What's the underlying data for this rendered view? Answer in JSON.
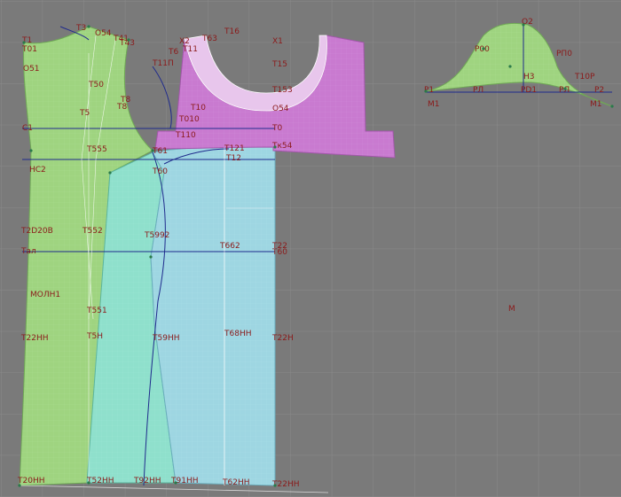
{
  "colors": {
    "background": "#7a7a7a",
    "grid": "#8a8a8a",
    "green_piece": "#9fd480",
    "cyan_piece": "#8fe0cc",
    "blue_piece": "#9ed6e2",
    "magenta_piece": "#c97ad0",
    "neck_facing": "#e8c6ec",
    "construction_line": "#1f2a8c",
    "label_color": "#8b1a1a"
  },
  "labels": {
    "T1": "T1",
    "T01": "T01",
    "O51": "O51",
    "T3": "T3",
    "O54a": "O54",
    "T41": "T41",
    "T43": "T43",
    "T6": "T6",
    "X2": "X2",
    "T11": "T11",
    "T63": "T63",
    "T16": "T16",
    "X1": "X1",
    "T11P": "T11П",
    "T15": "T15",
    "T50": "T50",
    "T8a": "T8",
    "T8b": "T8",
    "T5": "T5",
    "T10": "T10",
    "T153": "T153",
    "O54b": "O54",
    "T010": "T010",
    "C1": "C1",
    "T0": "T0",
    "T110": "T110",
    "T555": "T555",
    "T121": "T121",
    "T454": "Tк54",
    "T12": "T12",
    "T61": "T61",
    "HC2": "HC2",
    "T60": "T60",
    "T2D20B": "T2D20B",
    "T552": "T552",
    "T5992": "T5992",
    "T662": "T662",
    "T22a": "T22",
    "Tal": "Tал",
    "T60b": "T60",
    "MOLH1": "MOЛH1",
    "T551": "T551",
    "T22H": "T22HH",
    "T5H": "T5H",
    "T59H": "T59HH",
    "T68H": "T68HH",
    "T22Hb": "T22H",
    "T20HH": "T20HH",
    "T52HH": "T52HH",
    "T92HH": "T92HH",
    "T91HH": "T91HH",
    "T62HH": "T62HH",
    "T22HHb": "T22HH",
    "O2": "O2",
    "P00": "P00",
    "PP0": "PП0",
    "H3": "H3",
    "T10P": "T10P",
    "P1": "P1",
    "P11": "PЛ",
    "PD1": "PD1",
    "PN": "PЛ",
    "P2": "P2",
    "M1": "M1",
    "M2": "M1",
    "M": "M"
  }
}
